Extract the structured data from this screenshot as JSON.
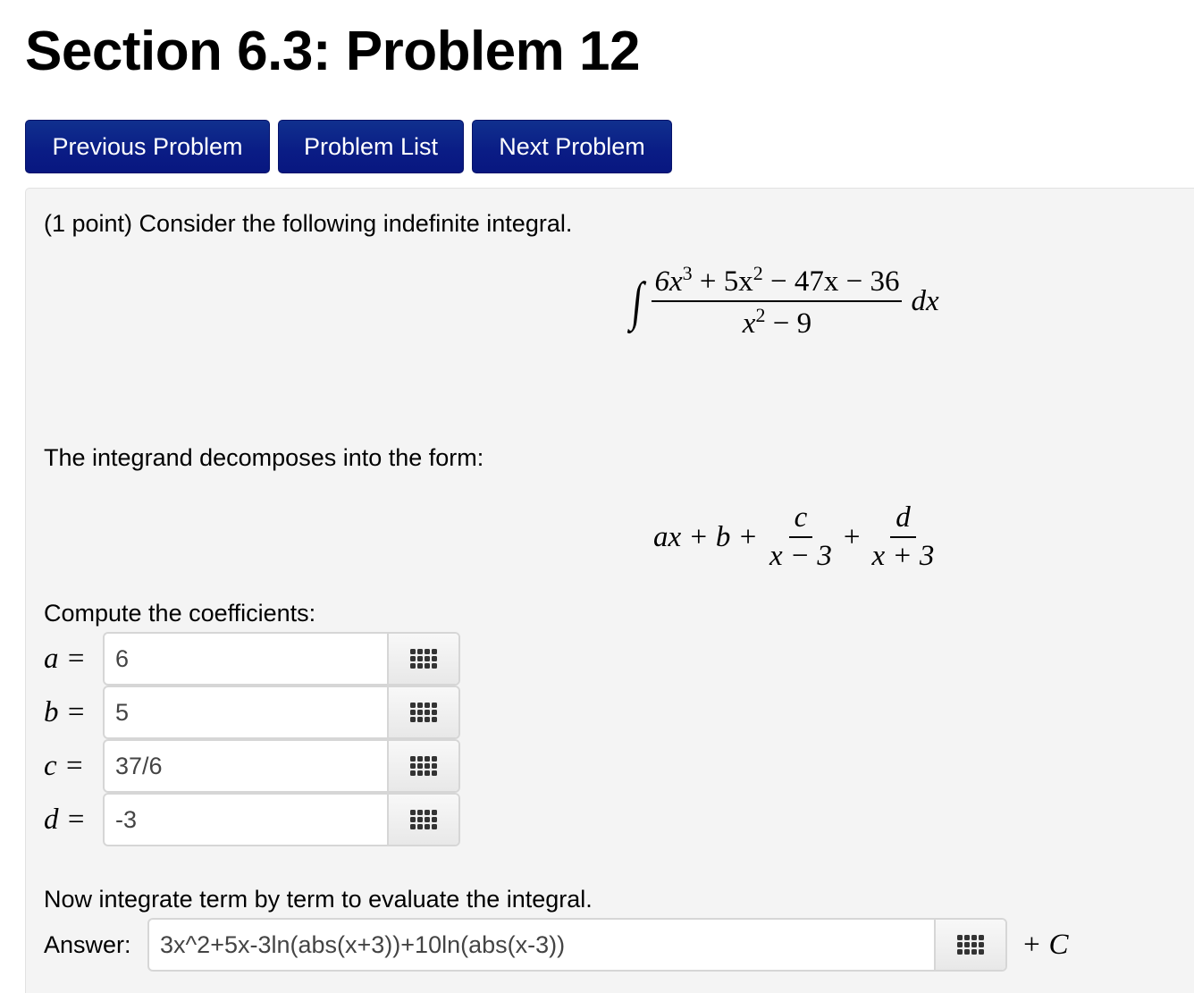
{
  "page": {
    "title": "Section 6.3: Problem 12"
  },
  "nav": {
    "previous_label": "Previous Problem",
    "list_label": "Problem List",
    "next_label": "Next Problem"
  },
  "problem": {
    "intro": "(1 point) Consider the following indefinite integral.",
    "integral": {
      "numerator": [
        "6x",
        "3",
        " + 5x",
        "2",
        " − 47x − 36"
      ],
      "denominator": [
        "x",
        "2",
        " − 9"
      ],
      "differential": "dx"
    },
    "decompose_text": "The integrand decomposes into the form:",
    "form": {
      "prefix": "ax + b +",
      "frac1_num": "c",
      "frac1_den": "x − 3",
      "plus": "+",
      "frac2_num": "d",
      "frac2_den": "x + 3"
    },
    "coeff_prompt": "Compute the coefficients:",
    "coefficients": [
      {
        "label": "a =",
        "value": "6"
      },
      {
        "label": "b =",
        "value": "5"
      },
      {
        "label": "c =",
        "value": "37/6"
      },
      {
        "label": "d =",
        "value": "-3"
      }
    ],
    "integrate_prompt": "Now integrate term by term to evaluate the integral.",
    "answer_label": "Answer:",
    "answer_value": "3x^2+5x-3ln(abs(x+3))+10ln(abs(x-3))",
    "constant_suffix": "+ C"
  },
  "icons": {
    "equation_editor": "keypad-grid-icon"
  }
}
